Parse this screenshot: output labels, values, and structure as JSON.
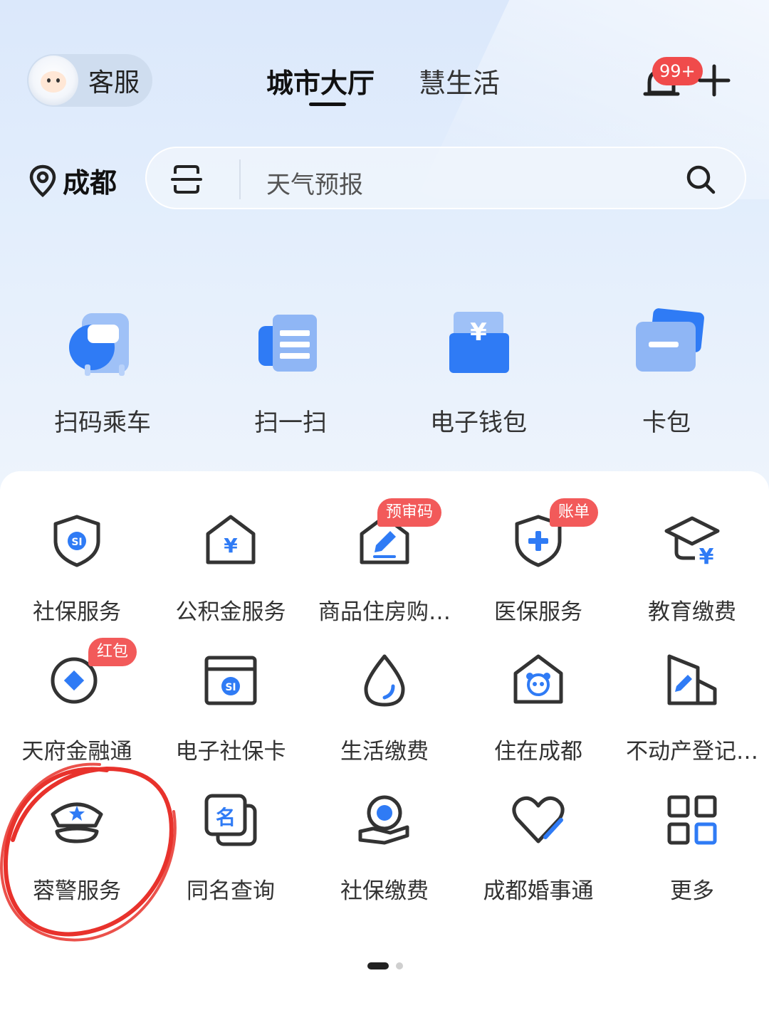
{
  "header": {
    "customer_service_label": "客服",
    "tabs": [
      {
        "label": "城市大厅",
        "active": true
      },
      {
        "label": "慧生活",
        "active": false
      }
    ],
    "notification_badge": "99+"
  },
  "location": {
    "city": "成都"
  },
  "search": {
    "placeholder": "天气预报"
  },
  "quick_actions": [
    {
      "label": "扫码乘车",
      "icon": "bus-qr-icon"
    },
    {
      "label": "扫一扫",
      "icon": "scan-icon"
    },
    {
      "label": "电子钱包",
      "icon": "wallet-icon"
    },
    {
      "label": "卡包",
      "icon": "card-pack-icon"
    }
  ],
  "services": [
    {
      "label": "社保服务",
      "icon": "shield-si-icon"
    },
    {
      "label": "公积金服务",
      "icon": "house-yuan-icon"
    },
    {
      "label": "商品住房购…",
      "icon": "house-edit-icon",
      "tag": "预审码"
    },
    {
      "label": "医保服务",
      "icon": "shield-plus-icon",
      "tag": "账单"
    },
    {
      "label": "教育缴费",
      "icon": "graduation-yuan-icon"
    },
    {
      "label": "天府金融通",
      "icon": "finance-icon",
      "tag": "红包"
    },
    {
      "label": "电子社保卡",
      "icon": "si-card-icon"
    },
    {
      "label": "生活缴费",
      "icon": "water-drop-icon"
    },
    {
      "label": "住在成都",
      "icon": "house-panda-icon"
    },
    {
      "label": "不动产登记…",
      "icon": "building-edit-icon"
    },
    {
      "label": "蓉警服务",
      "icon": "police-cap-icon"
    },
    {
      "label": "同名查询",
      "icon": "name-search-icon"
    },
    {
      "label": "社保缴费",
      "icon": "si-pay-icon"
    },
    {
      "label": "成都婚事通",
      "icon": "heart-icon"
    },
    {
      "label": "更多",
      "icon": "more-grid-icon"
    }
  ],
  "colors": {
    "accent": "#2f7bf5",
    "badge": "#f04b4b",
    "annotation": "#e8322c"
  }
}
